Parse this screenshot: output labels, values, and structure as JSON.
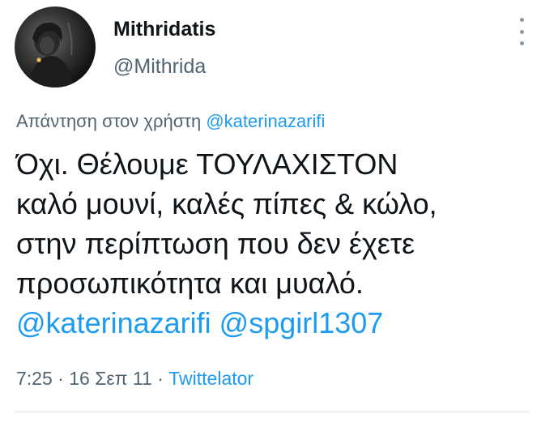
{
  "author": {
    "display_name": "Mithridatis",
    "handle": "@Mithrida"
  },
  "reply": {
    "prefix": "Απάντηση στον χρήστη",
    "mention": "@katerinazarifi"
  },
  "tweet": {
    "lines": [
      "Όχι. Θέλουμε ΤΟΥΛΑΧΙΣΤΟΝ",
      "καλό μουνί, καλές πίπες & κώλο,",
      "στην περίπτωση που δεν έχετε",
      "προσωπικότητα και μυαλό."
    ],
    "mentions": [
      "@katerinazarifi",
      "@spgirl1307"
    ]
  },
  "meta": {
    "time": "7:25",
    "separator": "·",
    "date": "16 Σεπ 11",
    "source": "Twittelator"
  },
  "colors": {
    "link": "#1d9bf0",
    "secondary_text": "#536471",
    "primary_text": "#0f1419"
  },
  "icons": {
    "more": "vertical-ellipsis-icon",
    "avatar": "profile-photo"
  }
}
